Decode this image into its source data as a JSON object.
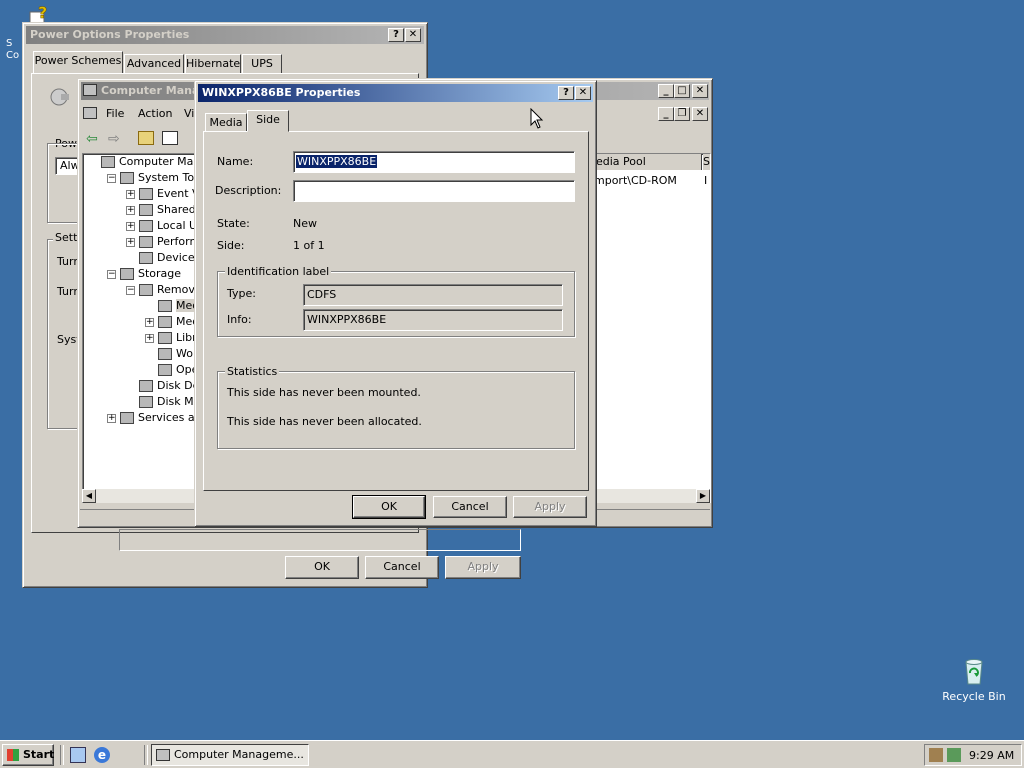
{
  "desktop": {
    "icons": [
      {
        "name": "help-icon",
        "label": "S\nCo"
      },
      {
        "name": "recycle-bin-icon",
        "label": "Recycle Bin"
      }
    ]
  },
  "power_options": {
    "title": "Power Options Properties",
    "tabs": [
      "Power Schemes",
      "Advanced",
      "Hibernate",
      "UPS"
    ],
    "labels": {
      "pow": "Pow",
      "alw": "Alw",
      "setti": "Setti",
      "turn1": "Turr",
      "turn2": "Turr",
      "syst": "Syst"
    },
    "buttons": {
      "ok": "OK",
      "cancel": "Cancel",
      "apply": "Apply"
    }
  },
  "computer_management": {
    "title": "Computer Manag",
    "menu": [
      "File",
      "Action",
      "Vi"
    ],
    "columns": [
      "edia Pool",
      "S"
    ],
    "row": [
      "mport\\CD-ROM",
      "I"
    ],
    "tree": [
      {
        "label": "Computer Manage",
        "indent": 0,
        "expander": "none"
      },
      {
        "label": "System Tools",
        "indent": 1,
        "expander": "minus"
      },
      {
        "label": "Event View",
        "indent": 2,
        "expander": "plus"
      },
      {
        "label": "Shared Fo",
        "indent": 2,
        "expander": "plus"
      },
      {
        "label": "Local User",
        "indent": 2,
        "expander": "plus"
      },
      {
        "label": "Performan",
        "indent": 2,
        "expander": "plus"
      },
      {
        "label": "Device Ma",
        "indent": 2,
        "expander": "none"
      },
      {
        "label": "Storage",
        "indent": 1,
        "expander": "minus"
      },
      {
        "label": "Removable",
        "indent": 2,
        "expander": "minus"
      },
      {
        "label": "Media",
        "indent": 3,
        "expander": "none",
        "selected": true
      },
      {
        "label": "Media",
        "indent": 3,
        "expander": "plus"
      },
      {
        "label": "Librarie",
        "indent": 3,
        "expander": "plus"
      },
      {
        "label": "Work Q",
        "indent": 3,
        "expander": "none"
      },
      {
        "label": "Opera",
        "indent": 3,
        "expander": "none"
      },
      {
        "label": "Disk Defra",
        "indent": 2,
        "expander": "none"
      },
      {
        "label": "Disk Manag",
        "indent": 2,
        "expander": "none"
      },
      {
        "label": "Services and A",
        "indent": 1,
        "expander": "plus"
      }
    ]
  },
  "dialog": {
    "title": "WINXPPX86BE Properties",
    "tabs": [
      "Media",
      "Side"
    ],
    "active_tab": "Side",
    "name_label": "Name:",
    "name_value": "WINXPPX86BE",
    "description_label": "Description:",
    "description_value": "",
    "state_label": "State:",
    "state_value": "New",
    "side_label": "Side:",
    "side_value": "1 of 1",
    "id_group": "Identification label",
    "type_label": "Type:",
    "type_value": "CDFS",
    "info_label": "Info:",
    "info_value": "WINXPPX86BE",
    "stats_group": "Statistics",
    "stats_line1": "This side has never been mounted.",
    "stats_line2": "This side has never been allocated.",
    "buttons": {
      "ok": "OK",
      "cancel": "Cancel",
      "apply": "Apply"
    }
  },
  "taskbar": {
    "start": "Start",
    "task": "Computer Manageme...",
    "clock": "9:29 AM"
  },
  "colors": {
    "desktop": "#3a6ea5",
    "active_title": "#0a246a",
    "face": "#d4d0c8"
  }
}
